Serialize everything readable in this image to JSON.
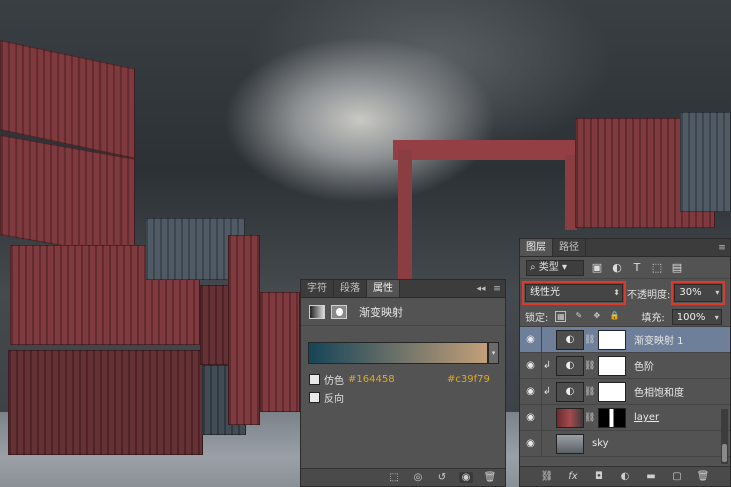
{
  "properties_panel": {
    "tabs": [
      "字符",
      "段落",
      "属性"
    ],
    "active_tab": "属性",
    "title": "渐变映射",
    "gradient": {
      "start_color": "#164458",
      "end_color": "#c39f79"
    },
    "dither_label": "仿色",
    "reverse_label": "反向",
    "start_hex": "#164458",
    "end_hex": "#c39f79",
    "footer_icons": [
      "clip-to-layer-icon",
      "view-previous-icon",
      "reset-icon",
      "visibility-icon",
      "delete-icon"
    ]
  },
  "layers_panel": {
    "tabs": [
      "图层",
      "路径"
    ],
    "active_tab": "图层",
    "kind_filter": "类型",
    "blend_mode": "线性光",
    "opacity_label": "不透明度:",
    "opacity_value": "30%",
    "lock_label": "锁定:",
    "fill_label": "填充:",
    "fill_value": "100%",
    "layers": [
      {
        "name": "渐变映射 1",
        "type": "adjustment",
        "selected": true,
        "clipped": false
      },
      {
        "name": "色阶",
        "type": "adjustment",
        "selected": false,
        "clipped": true
      },
      {
        "name": "色相饱和度",
        "type": "adjustment",
        "selected": false,
        "clipped": true
      },
      {
        "name": "layer",
        "type": "image-with-mask",
        "selected": false,
        "clipped": false
      },
      {
        "name": "sky",
        "type": "image",
        "selected": false,
        "clipped": false
      }
    ],
    "footer_icons": [
      "link-icon",
      "fx-icon",
      "add-mask-icon",
      "adjustment-icon",
      "group-icon",
      "new-layer-icon",
      "delete-icon"
    ]
  },
  "colors": {
    "highlight_outline": "#e0392b",
    "selected_layer": "#6d7f99",
    "hex_text": "#e0a72a"
  }
}
